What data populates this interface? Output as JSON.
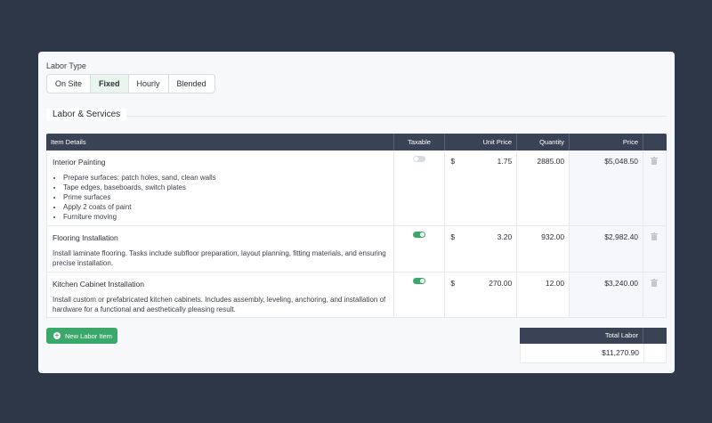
{
  "labor_type": {
    "label": "Labor Type",
    "options": [
      "On Site",
      "Fixed",
      "Hourly",
      "Blended"
    ],
    "selected": "Fixed"
  },
  "section_title": "Labor & Services",
  "table": {
    "headers": [
      "Item Details",
      "Taxable",
      "Unit Price",
      "Quantity",
      "Price"
    ],
    "rows": [
      {
        "name": "Interior Painting",
        "bullets": [
          "Prepare surfaces: patch holes, sand, clean walls",
          "Tape edges, baseboards, switch plates",
          "Prime surfaces",
          "Apply 2 coats of paint",
          "Furniture moving"
        ],
        "description": "",
        "taxable": false,
        "currency": "$",
        "unit_price": "1.75",
        "quantity": "2885.00",
        "price": "$5,048.50"
      },
      {
        "name": "Flooring Installation",
        "bullets": [],
        "description": "Install laminate flooring. Tasks include subfloor preparation, layout planning, fitting materials, and ensuring precise installation.",
        "taxable": true,
        "currency": "$",
        "unit_price": "3.20",
        "quantity": "932.00",
        "price": "$2,982.40"
      },
      {
        "name": "Kitchen Cabinet Installation",
        "bullets": [],
        "description": "Install custom or prefabricated kitchen cabinets. Includes assembly, leveling, anchoring, and installation of hardware for a functional and aesthetically pleasing result.",
        "taxable": true,
        "currency": "$",
        "unit_price": "270.00",
        "quantity": "12.00",
        "price": "$3,240.00"
      }
    ]
  },
  "new_item_label": "New Labor Item",
  "total": {
    "label": "Total Labor",
    "value": "$11,270.90"
  },
  "colors": {
    "accent": "#3aa86b",
    "header": "#3a4355",
    "background": "#2e3747"
  },
  "icons": {
    "delete": "trash-icon",
    "add": "plus-circle-icon"
  }
}
